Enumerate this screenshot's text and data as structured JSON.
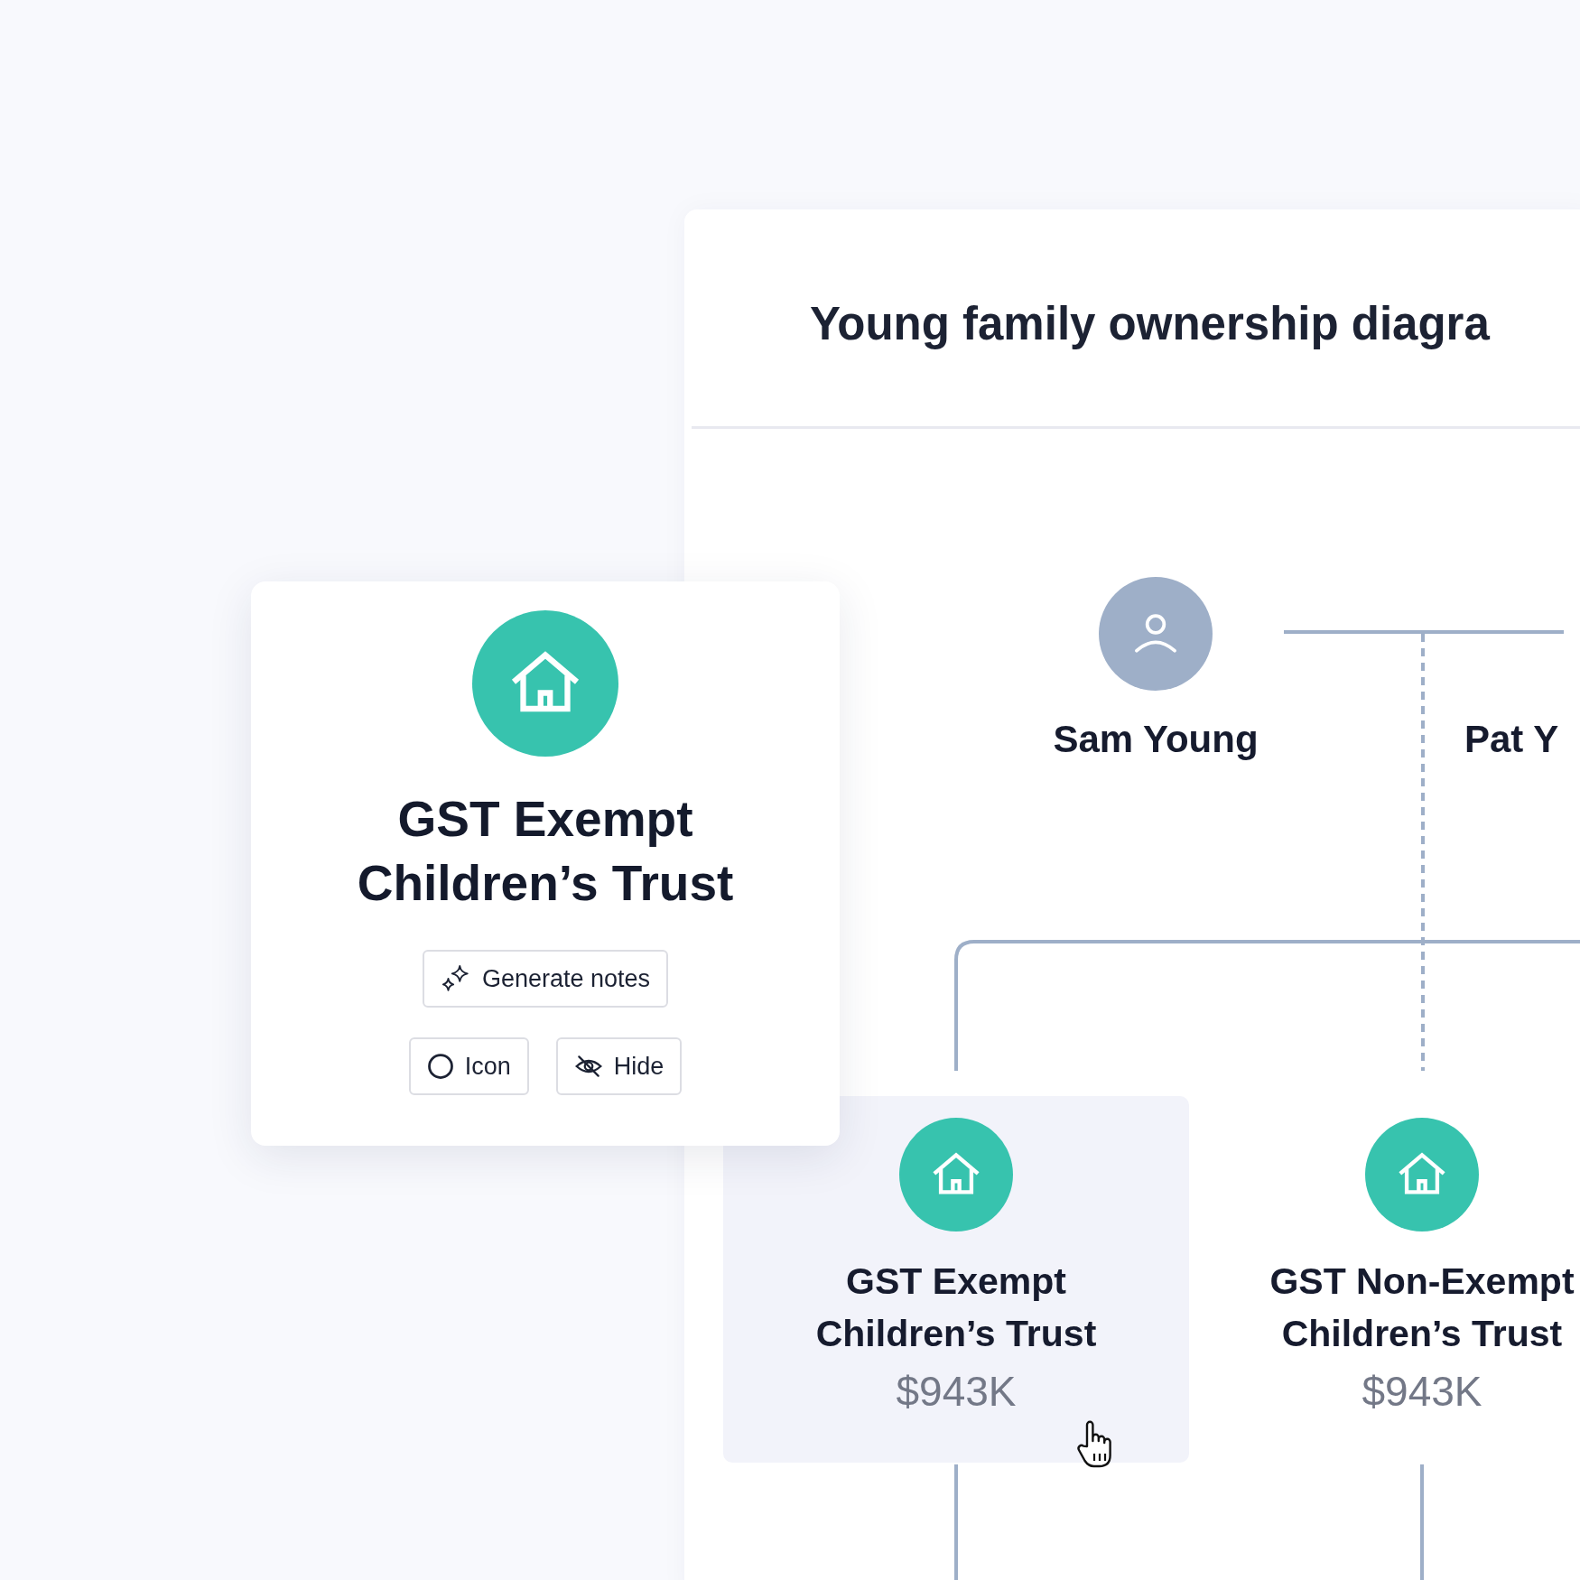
{
  "diagram": {
    "title": "Young family ownership diagra",
    "people": [
      {
        "name": "Sam Young"
      },
      {
        "name": "Pat Y"
      }
    ],
    "entities": [
      {
        "name_lines": [
          "GST Exempt",
          "Children’s Trust"
        ],
        "value": "$943K",
        "selected": true
      },
      {
        "name_lines": [
          "GST Non-Exempt",
          "Children’s Trust"
        ],
        "value": "$943K",
        "selected": false
      }
    ]
  },
  "popup": {
    "title_lines": [
      "GST Exempt",
      "Children’s Trust"
    ],
    "buttons": [
      {
        "label": "Generate notes",
        "kind": "sparkle"
      },
      {
        "label": "Icon",
        "kind": "circle"
      },
      {
        "label": "Hide",
        "kind": "hide"
      }
    ]
  }
}
